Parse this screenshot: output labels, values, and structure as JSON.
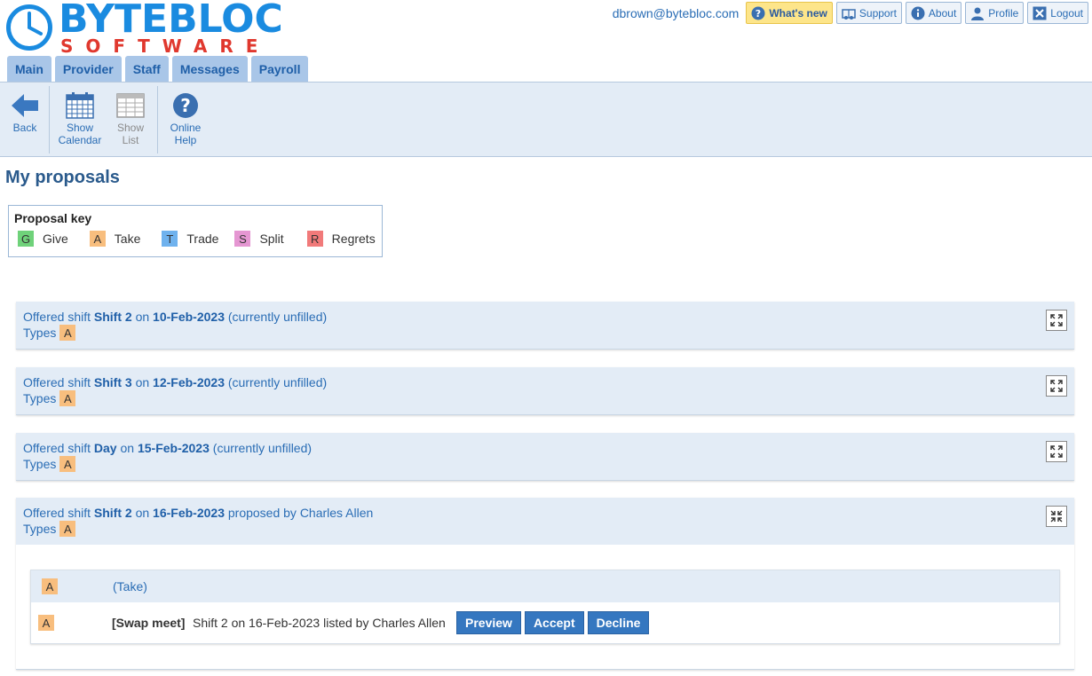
{
  "header": {
    "logo_top": "BYTEBLOC",
    "logo_bottom": "SOFTWARE",
    "user_email": "dbrown@bytebloc.com",
    "buttons": [
      {
        "label": "What's new",
        "icon": "question-circle-icon"
      },
      {
        "label": "Support",
        "icon": "support-icon"
      },
      {
        "label": "About",
        "icon": "info-icon"
      },
      {
        "label": "Profile",
        "icon": "user-icon"
      },
      {
        "label": "Logout",
        "icon": "close-icon"
      }
    ]
  },
  "tabs": [
    "Main",
    "Provider",
    "Staff",
    "Messages",
    "Payroll"
  ],
  "toolbar": {
    "back": "Back",
    "show_calendar_1": "Show",
    "show_calendar_2": "Calendar",
    "show_list_1": "Show",
    "show_list_2": "List",
    "online_help_1": "Online",
    "online_help_2": "Help"
  },
  "page_title": "My proposals",
  "key": {
    "title": "Proposal key",
    "items": [
      {
        "code": "G",
        "label": "Give"
      },
      {
        "code": "A",
        "label": "Take"
      },
      {
        "code": "T",
        "label": "Trade"
      },
      {
        "code": "S",
        "label": "Split"
      },
      {
        "code": "R",
        "label": "Regrets"
      }
    ]
  },
  "proposals": [
    {
      "prefix": "Offered shift",
      "shift": "Shift 2",
      "on": "on",
      "date": "10-Feb-2023",
      "suffix": "(currently unfilled)",
      "types_label": "Types",
      "type": "A"
    },
    {
      "prefix": "Offered shift",
      "shift": "Shift 3",
      "on": "on",
      "date": "12-Feb-2023",
      "suffix": "(currently unfilled)",
      "types_label": "Types",
      "type": "A"
    },
    {
      "prefix": "Offered shift",
      "shift": "Day",
      "on": "on",
      "date": "15-Feb-2023",
      "suffix": "(currently unfilled)",
      "types_label": "Types",
      "type": "A"
    },
    {
      "prefix": "Offered shift",
      "shift": "Shift 2",
      "on": "on",
      "date": "16-Feb-2023",
      "suffix": "proposed by Charles Allen",
      "types_label": "Types",
      "type": "A",
      "detail": {
        "head_type": "A",
        "head_label": "(Take)",
        "row_type": "A",
        "row_tag": "[Swap meet]",
        "row_desc": "Shift 2 on 16-Feb-2023 listed by Charles Allen",
        "actions": [
          "Preview",
          "Accept",
          "Decline"
        ]
      }
    }
  ]
}
